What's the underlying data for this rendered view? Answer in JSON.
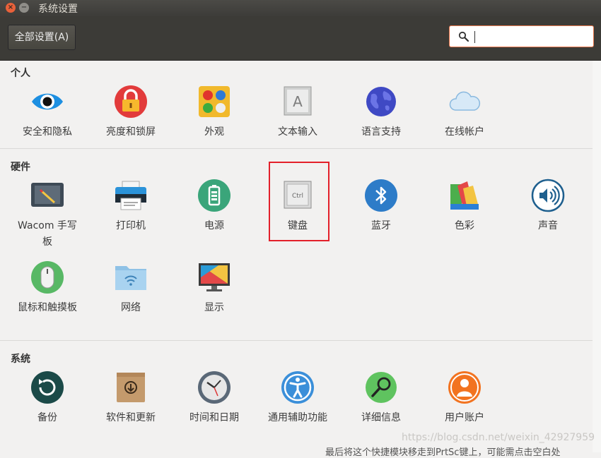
{
  "window": {
    "title": "系统设置"
  },
  "toolbar": {
    "all_settings_label": "全部设置(A)",
    "search_value": ""
  },
  "sections": {
    "personal": {
      "title": "个人",
      "items": [
        "安全和隐私",
        "亮度和锁屏",
        "外观",
        "文本输入",
        "语言支持",
        "在线帐户"
      ]
    },
    "hardware": {
      "title": "硬件",
      "items": [
        "Wacom 手写板",
        "打印机",
        "电源",
        "键盘",
        "蓝牙",
        "色彩",
        "声音",
        "鼠标和触摸板",
        "网络",
        "显示"
      ]
    },
    "system": {
      "title": "系统",
      "items": [
        "备份",
        "软件和更新",
        "时间和日期",
        "通用辅助功能",
        "详细信息",
        "用户账户"
      ]
    }
  },
  "icons": {
    "keyboard_key": "Ctrl"
  },
  "watermark": "https://blog.csdn.net/weixin_42927959",
  "bottom_text": "最后将这个快捷模块移走到PrtSc键上，可能需点击空白处"
}
